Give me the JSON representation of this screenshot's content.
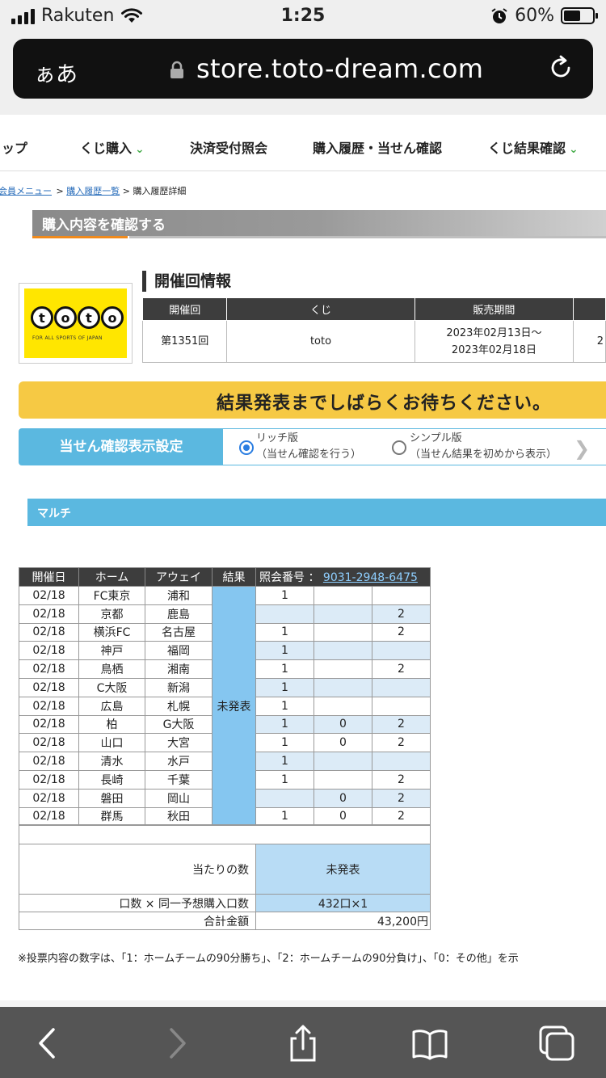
{
  "status_bar": {
    "carrier": "Rakuten",
    "time": "1:25",
    "battery": "60%",
    "battery_level": 0.6
  },
  "browser": {
    "aa_label": "ぁあ",
    "url": "store.toto-dream.com"
  },
  "nav": {
    "items": [
      {
        "label": "トップ",
        "chevron": false
      },
      {
        "label": "くじ購入",
        "chevron": true
      },
      {
        "label": "決済受付照会",
        "chevron": false
      },
      {
        "label": "購入履歴・当せん確認",
        "chevron": false
      },
      {
        "label": "くじ結果確認",
        "chevron": true
      }
    ]
  },
  "breadcrumb": {
    "item1": "会員メニュー",
    "sep": " > ",
    "item2": "購入履歴一覧",
    "item3": "購入履歴詳細"
  },
  "section_title": "購入内容を確認する",
  "logo": {
    "letters": [
      "t",
      "o",
      "t",
      "o"
    ],
    "tagline": "FOR ALL SPORTS OF JAPAN"
  },
  "kaisai": {
    "heading": "開催回情報",
    "headers": [
      "開催回",
      "くじ",
      "販売期間",
      ""
    ],
    "row": {
      "kaisai": "第1351回",
      "kuji": "toto",
      "period_start": "2023年02月13日〜",
      "period_end": "2023年02月18日",
      "extra": "2"
    }
  },
  "banner": "結果発表までしばらくお待ちください。",
  "display_setting": {
    "label": "当せん確認表示設定",
    "option1": {
      "title": "リッチ版",
      "sub": "（当せん確認を行う）",
      "selected": true
    },
    "option2": {
      "title": "シンプル版",
      "sub": "（当せん結果を初めから表示）",
      "selected": false
    }
  },
  "multi_label": "マルチ",
  "matches": {
    "headers": {
      "date": "開催日",
      "home": "ホーム",
      "away": "アウェイ",
      "result": "結果",
      "ref_label": "照会番号 ：",
      "ref_no": "9031-2948-6475"
    },
    "result_text": "未発表",
    "rows": [
      {
        "date": "02/18",
        "home": "FC東京",
        "away": "浦和",
        "p1": "1",
        "p0": "",
        "p2": ""
      },
      {
        "date": "02/18",
        "home": "京都",
        "away": "鹿島",
        "p1": "",
        "p0": "",
        "p2": "2"
      },
      {
        "date": "02/18",
        "home": "横浜FC",
        "away": "名古屋",
        "p1": "1",
        "p0": "",
        "p2": "2"
      },
      {
        "date": "02/18",
        "home": "神戸",
        "away": "福岡",
        "p1": "1",
        "p0": "",
        "p2": ""
      },
      {
        "date": "02/18",
        "home": "鳥栖",
        "away": "湘南",
        "p1": "1",
        "p0": "",
        "p2": "2"
      },
      {
        "date": "02/18",
        "home": "C大阪",
        "away": "新潟",
        "p1": "1",
        "p0": "",
        "p2": ""
      },
      {
        "date": "02/18",
        "home": "広島",
        "away": "札幌",
        "p1": "1",
        "p0": "",
        "p2": ""
      },
      {
        "date": "02/18",
        "home": "柏",
        "away": "G大阪",
        "p1": "1",
        "p0": "0",
        "p2": "2"
      },
      {
        "date": "02/18",
        "home": "山口",
        "away": "大宮",
        "p1": "1",
        "p0": "0",
        "p2": "2"
      },
      {
        "date": "02/18",
        "home": "清水",
        "away": "水戸",
        "p1": "1",
        "p0": "",
        "p2": ""
      },
      {
        "date": "02/18",
        "home": "長崎",
        "away": "千葉",
        "p1": "1",
        "p0": "",
        "p2": "2"
      },
      {
        "date": "02/18",
        "home": "磐田",
        "away": "岡山",
        "p1": "",
        "p0": "0",
        "p2": "2"
      },
      {
        "date": "02/18",
        "home": "群馬",
        "away": "秋田",
        "p1": "1",
        "p0": "0",
        "p2": "2"
      }
    ]
  },
  "summary": {
    "hits_label": "当たりの数",
    "hits_value": "未発表",
    "units_label": "口数 × 同一予想購入口数",
    "units_value": "432口×1",
    "total_label": "合計金額",
    "total_value": "43,200円"
  },
  "note": "※投票内容の数字は、「1：ホームチームの90分勝ち」、「2：ホームチームの90分負け」、「0：その他」を示"
}
